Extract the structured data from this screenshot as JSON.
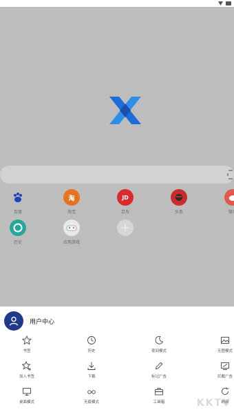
{
  "user": {
    "title": "用户中心"
  },
  "shortcuts": [
    {
      "label": "百度",
      "color": "#1f3fbf"
    },
    {
      "label": "淘宝",
      "color": "#e5731f"
    },
    {
      "label": "京东",
      "color": "#d92b2b"
    },
    {
      "label": "头条",
      "color": "#c82d2d"
    },
    {
      "label": "微博",
      "color": "#e05a4a"
    },
    {
      "label": "历史",
      "color": "#27a79a"
    },
    {
      "label": "应用游戏",
      "color": "#f0f0f0"
    },
    {
      "label": "",
      "color": "#d6d6d6"
    }
  ],
  "shortcut_icon_text": {
    "taobao": "淘",
    "jd": "JD"
  },
  "menu": [
    {
      "label": "书签",
      "icon": "star-icon"
    },
    {
      "label": "历史",
      "icon": "clock-icon"
    },
    {
      "label": "夜间模式",
      "icon": "moon-icon"
    },
    {
      "label": "无图模式",
      "icon": "image-icon"
    },
    {
      "label": "加入书签",
      "icon": "star-add-icon"
    },
    {
      "label": "下载",
      "icon": "download-icon"
    },
    {
      "label": "标记广告",
      "icon": "pen-icon"
    },
    {
      "label": "拦截广告",
      "icon": "monitor-block-icon"
    },
    {
      "label": "桌面模式",
      "icon": "desktop-icon"
    },
    {
      "label": "无痕模式",
      "icon": "glasses-icon"
    },
    {
      "label": "工具箱",
      "icon": "toolbox-icon"
    },
    {
      "label": "刷新",
      "icon": "refresh-icon"
    }
  ],
  "watermark": "KKTV",
  "colors": {
    "accent": "#1f3a8a",
    "logo_blue": "#1e6cd6",
    "overlay": "#bdbdbd"
  }
}
